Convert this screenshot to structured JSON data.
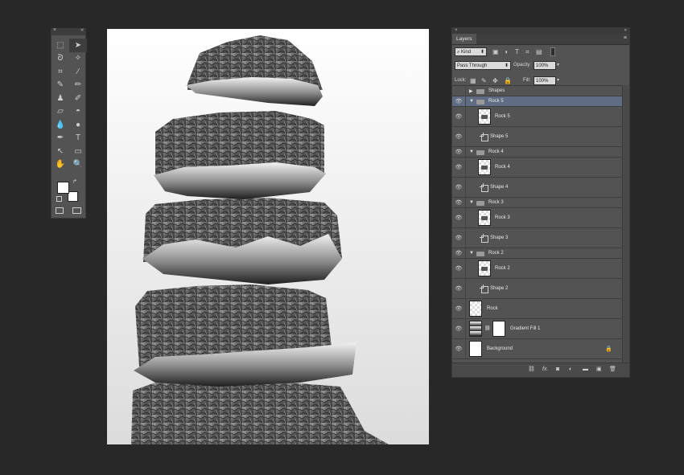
{
  "tools_panel": {
    "collapse_glyph": "«",
    "close_glyph": "×",
    "tools": [
      {
        "icon": "marquee-icon",
        "glyph": "⬚"
      },
      {
        "icon": "path-selection-icon",
        "glyph": "➤"
      },
      {
        "icon": "lasso-icon",
        "glyph": "ᘐ"
      },
      {
        "icon": "magic-wand-icon",
        "glyph": "✧"
      },
      {
        "icon": "crop-icon",
        "glyph": "⌗"
      },
      {
        "icon": "eyedropper-icon",
        "glyph": "⁄"
      },
      {
        "icon": "spot-healing-icon",
        "glyph": "✎"
      },
      {
        "icon": "brush-icon",
        "glyph": "✏"
      },
      {
        "icon": "clone-stamp-icon",
        "glyph": "♟"
      },
      {
        "icon": "history-brush-icon",
        "glyph": "✐"
      },
      {
        "icon": "eraser-icon",
        "glyph": "▱"
      },
      {
        "icon": "paint-bucket-icon",
        "glyph": "◓"
      },
      {
        "icon": "blur-icon",
        "glyph": "💧"
      },
      {
        "icon": "dodge-icon",
        "glyph": "●"
      },
      {
        "icon": "pen-icon",
        "glyph": "✒"
      },
      {
        "icon": "type-icon",
        "glyph": "T"
      },
      {
        "icon": "direct-selection-icon",
        "glyph": "↖"
      },
      {
        "icon": "rectangle-shape-icon",
        "glyph": "▭"
      },
      {
        "icon": "hand-icon",
        "glyph": "✋"
      },
      {
        "icon": "zoom-icon",
        "glyph": "🔍"
      }
    ],
    "foreground_color": "#ffffff",
    "background_color": "#ffffff"
  },
  "layers_panel": {
    "tab_title": "Layers",
    "menu_glyph": "≡",
    "filter_kind": "Kind",
    "blend_mode": "Pass Through",
    "opacity_label": "Opacity:",
    "opacity_value": "100%",
    "lock_label": "Lock:",
    "fill_label": "Fill:",
    "fill_value": "100%",
    "selection_color": "#5f6c84",
    "layers": [
      {
        "name": "Shapes",
        "kind": "group-collapsed",
        "visible": false,
        "selected": false
      },
      {
        "name": "Rock 5",
        "kind": "group-open",
        "visible": true,
        "selected": true
      },
      {
        "name": "Rock 5",
        "kind": "pixel",
        "visible": true,
        "selected": false
      },
      {
        "name": "Shape 5",
        "kind": "shape",
        "visible": true,
        "selected": false
      },
      {
        "name": "Rock 4",
        "kind": "group-open",
        "visible": true,
        "selected": false
      },
      {
        "name": "Rock 4",
        "kind": "pixel",
        "visible": true,
        "selected": false
      },
      {
        "name": "Shape 4",
        "kind": "shape",
        "visible": true,
        "selected": false
      },
      {
        "name": "Rock 3",
        "kind": "group-open",
        "visible": true,
        "selected": false
      },
      {
        "name": "Rock 3",
        "kind": "pixel",
        "visible": true,
        "selected": false
      },
      {
        "name": "Shape 3",
        "kind": "shape",
        "visible": true,
        "selected": false
      },
      {
        "name": "Rock 2",
        "kind": "group-open",
        "visible": true,
        "selected": false
      },
      {
        "name": "Rock 2",
        "kind": "pixel",
        "visible": true,
        "selected": false
      },
      {
        "name": "Shape 2",
        "kind": "shape",
        "visible": true,
        "selected": false
      },
      {
        "name": "Rock",
        "kind": "pixel-top",
        "visible": true,
        "selected": false
      },
      {
        "name": "Gradient Fill 1",
        "kind": "fill",
        "visible": true,
        "selected": false
      },
      {
        "name": "Background",
        "kind": "background",
        "visible": true,
        "selected": false
      }
    ],
    "footer_icons": [
      "link-layers-icon",
      "fx-icon",
      "layer-mask-icon",
      "adjustment-layer-icon",
      "new-group-icon",
      "new-layer-icon",
      "trash-icon"
    ]
  }
}
